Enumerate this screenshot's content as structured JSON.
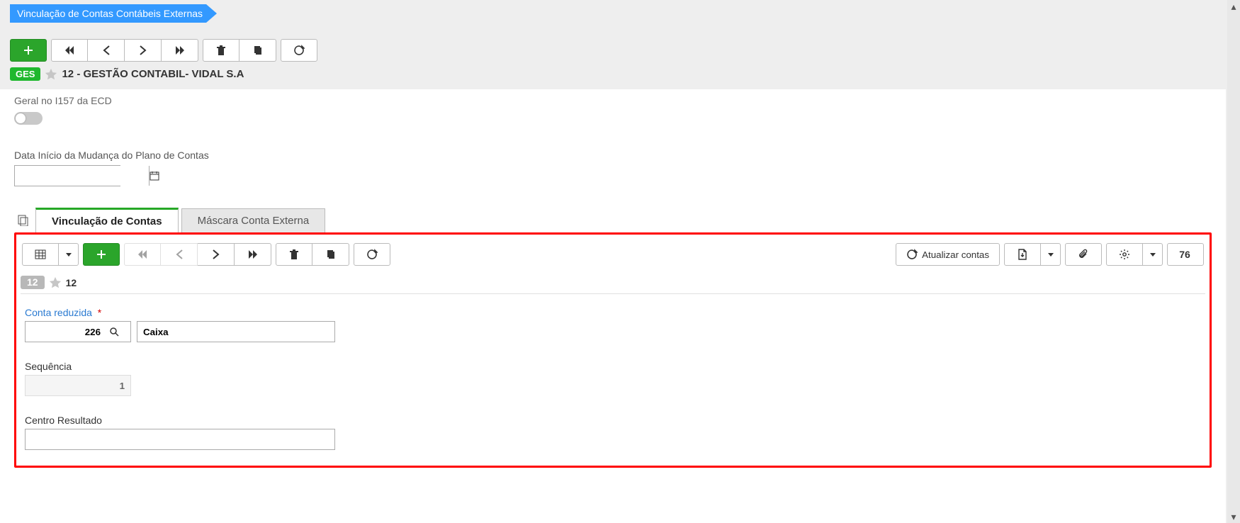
{
  "breadcrumb": "Vinculação de Contas Contábeis Externas",
  "header": {
    "tag": "GES",
    "title": "12 - GESTÃO CONTABIL- VIDAL S.A"
  },
  "main": {
    "ecd_label": "Geral no I157 da ECD",
    "date_label": "Data Início da Mudança do Plano de Contas"
  },
  "tabs": {
    "active": "Vinculação de Contas",
    "secondary": "Máscara Conta Externa"
  },
  "inner": {
    "atualizar": "Atualizar contas",
    "count": "76",
    "row_badge": "12",
    "row_id": "12"
  },
  "form": {
    "conta_label": "Conta reduzida",
    "conta_code": "226",
    "conta_desc": "Caixa",
    "seq_label": "Sequência",
    "seq_value": "1",
    "centro_label": "Centro Resultado",
    "centro_value": ""
  }
}
